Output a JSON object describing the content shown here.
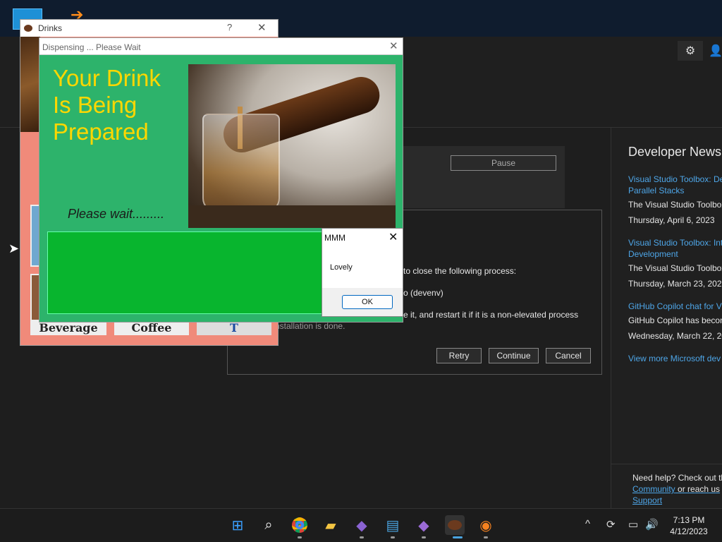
{
  "drinks_window": {
    "title": "Drinks",
    "help_glyph": "?",
    "close_glyph": "✕",
    "thumb_labels": [
      "Beverage",
      "Coffee",
      "T"
    ]
  },
  "dispensing_window": {
    "title": "Dispensing ... Please Wait",
    "close_glyph": "✕",
    "heading_lines": [
      "Your Drink",
      "Is Being",
      "Prepared"
    ],
    "please_wait": "Please wait........."
  },
  "message_box": {
    "title": "MMM",
    "close_glyph": "✕",
    "message": "Lovely",
    "ok_label": "OK"
  },
  "installer": {
    "pause_label": "Pause",
    "dialog_lines": [
      "to close the following process:",
      "o (devenv)",
      "e it, and restart it if it is a non-elevated process",
      "nstallation is done."
    ],
    "retry_label": "Retry",
    "continue_label": "Continue",
    "cancel_label": "Cancel"
  },
  "news": {
    "title": "Developer News",
    "items": [
      {
        "link": "Visual Studio Toolbox: De",
        "link2": "Parallel Stacks",
        "text": "The Visual Studio Toolbox",
        "date": "Thursday, April 6, 2023"
      },
      {
        "link": "Visual Studio Toolbox: Int",
        "link2": "Development",
        "text": "The Visual Studio Toolbox",
        "date": "Thursday, March 23, 2023"
      },
      {
        "link": "GitHub Copilot chat for V",
        "link2": "",
        "text": "GitHub Copilot has becom",
        "date": "Wednesday, March 22, 20"
      }
    ],
    "more_link": "View more Microsoft dev",
    "help_text": "Need help? Check out th",
    "community_link": "Community",
    "reach_text": " or reach us",
    "support_link": "Support"
  },
  "taskbar": {
    "time": "7:13 PM",
    "date": "4/12/2023"
  }
}
